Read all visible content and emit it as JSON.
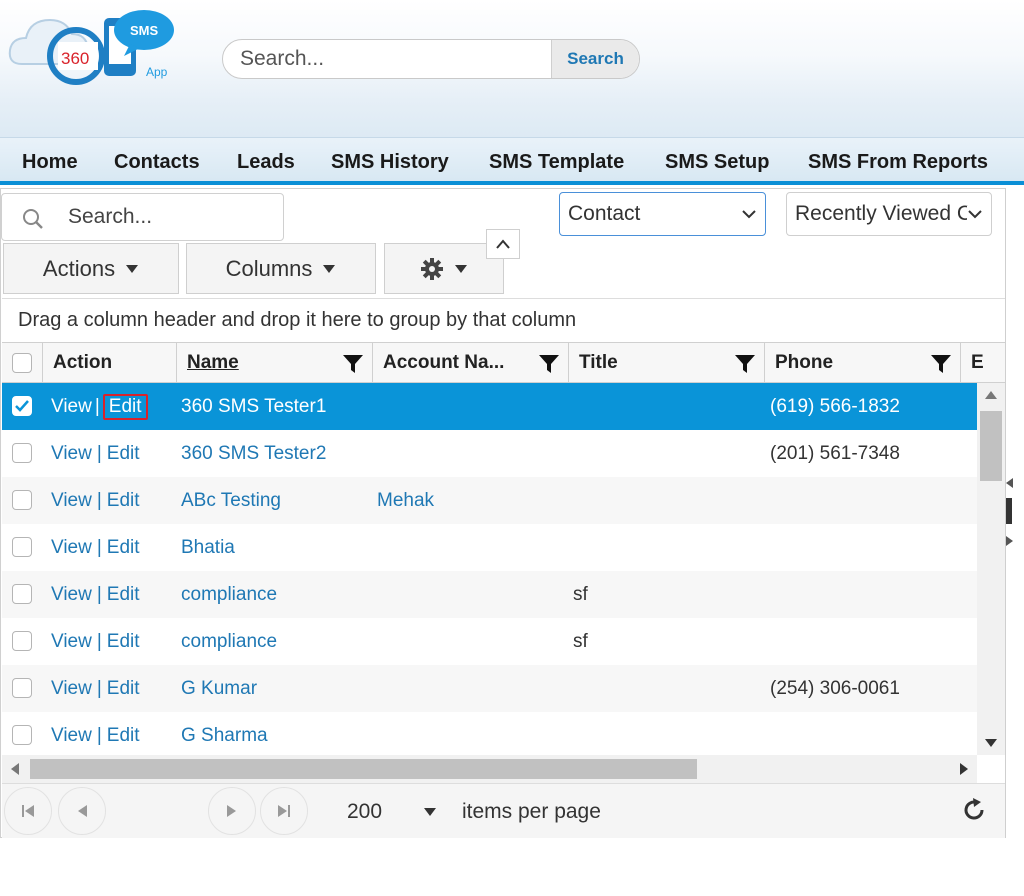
{
  "header": {
    "logo_text_1": "360",
    "logo_text_2": "SMS",
    "logo_text_3": "App",
    "search_placeholder": "Search...",
    "search_button": "Search"
  },
  "nav": {
    "items": [
      "Home",
      "Contacts",
      "Leads",
      "SMS History",
      "SMS Template",
      "SMS Setup",
      "SMS From Reports"
    ]
  },
  "grid": {
    "search_placeholder": "Search...",
    "object_select": "Contact",
    "view_select": "Recently Viewed C",
    "actions_label": "Actions",
    "columns_label": "Columns",
    "group_hint": "Drag a column header and drop it here to group by that column",
    "headers": [
      "Action",
      "Name",
      "Account Na...",
      "Title",
      "Phone",
      "E"
    ],
    "view_label": "View",
    "separator": "|",
    "edit_label": "Edit",
    "rows": [
      {
        "name": "360 SMS Tester1",
        "account": "",
        "title": "",
        "phone": "(619) 566-1832",
        "selected": true
      },
      {
        "name": "360 SMS Tester2",
        "account": "",
        "title": "",
        "phone": "(201) 561-7348",
        "selected": false
      },
      {
        "name": "ABc Testing",
        "account": "Mehak",
        "title": "",
        "phone": "",
        "selected": false
      },
      {
        "name": "Bhatia",
        "account": "",
        "title": "",
        "phone": "",
        "selected": false
      },
      {
        "name": "compliance",
        "account": "",
        "title": "sf",
        "phone": "",
        "selected": false
      },
      {
        "name": "compliance",
        "account": "",
        "title": "sf",
        "phone": "",
        "selected": false
      },
      {
        "name": "G Kumar",
        "account": "",
        "title": "",
        "phone": "(254) 306-0061",
        "selected": false
      },
      {
        "name": "G Sharma",
        "account": "",
        "title": "",
        "phone": "",
        "selected": false
      }
    ],
    "pager": {
      "per_page": "200",
      "per_page_label": "items per page"
    }
  },
  "colors": {
    "accent": "#0a94d8",
    "link": "#1f78b4",
    "highlight_border": "#d9232b"
  }
}
